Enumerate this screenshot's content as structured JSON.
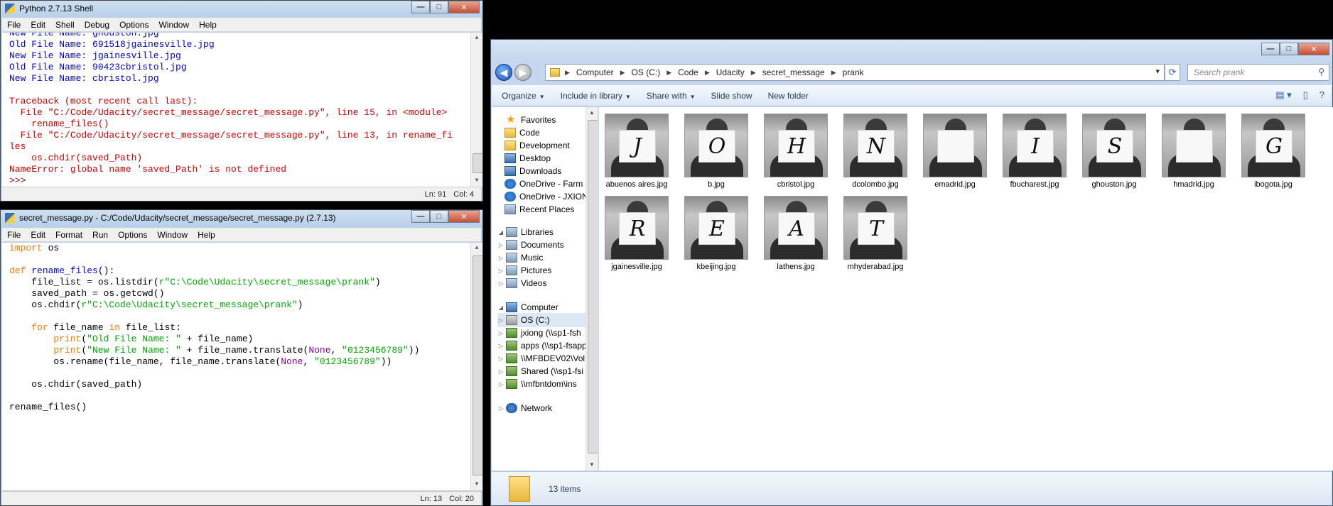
{
  "shell": {
    "title": "Python 2.7.13 Shell",
    "menu": [
      "File",
      "Edit",
      "Shell",
      "Debug",
      "Options",
      "Window",
      "Help"
    ],
    "lines": [
      {
        "text": "New File Name: ghouston.jpg",
        "cls": "c-blue"
      },
      {
        "text": "Old File Name: 691518jgainesville.jpg",
        "cls": "c-blue"
      },
      {
        "text": "New File Name: jgainesville.jpg",
        "cls": "c-blue"
      },
      {
        "text": "Old File Name: 90423cbristol.jpg",
        "cls": "c-blue"
      },
      {
        "text": "New File Name: cbristol.jpg",
        "cls": "c-blue"
      },
      {
        "text": "",
        "cls": ""
      },
      {
        "text": "Traceback (most recent call last):",
        "cls": "c-red"
      },
      {
        "text": "  File \"C:/Code/Udacity/secret_message/secret_message.py\", line 15, in <module>",
        "cls": "c-red"
      },
      {
        "text": "    rename_files()",
        "cls": "c-red"
      },
      {
        "text": "  File \"C:/Code/Udacity/secret_message/secret_message.py\", line 13, in rename_fi",
        "cls": "c-red"
      },
      {
        "text": "les",
        "cls": "c-red"
      },
      {
        "text": "    os.chdir(saved_Path)",
        "cls": "c-red"
      },
      {
        "text": "NameError: global name 'saved_Path' is not defined",
        "cls": "c-red"
      },
      {
        "text": ">>> ",
        "cls": "c-prompt"
      }
    ],
    "status_ln": "Ln: 91",
    "status_col": "Col: 4"
  },
  "editor": {
    "title": "secret_message.py - C:/Code/Udacity/secret_message/secret_message.py (2.7.13)",
    "menu": [
      "File",
      "Edit",
      "Format",
      "Run",
      "Options",
      "Window",
      "Help"
    ],
    "code": [
      [
        {
          "t": "import",
          "c": "c-kw"
        },
        {
          "t": " os",
          "c": ""
        }
      ],
      [],
      [
        {
          "t": "def",
          "c": "c-kw"
        },
        {
          "t": " ",
          "c": ""
        },
        {
          "t": "rename_files",
          "c": "c-def"
        },
        {
          "t": "():",
          "c": ""
        }
      ],
      [
        {
          "t": "    file_list = os.listdir(",
          "c": ""
        },
        {
          "t": "r\"C:\\Code\\Udacity\\secret_message\\prank\"",
          "c": "c-str"
        },
        {
          "t": ")",
          "c": ""
        }
      ],
      [
        {
          "t": "    saved_path = os.getcwd()",
          "c": ""
        }
      ],
      [
        {
          "t": "    os.chdir(",
          "c": ""
        },
        {
          "t": "r\"C:\\Code\\Udacity\\secret_message\\prank\"",
          "c": "c-str"
        },
        {
          "t": ")",
          "c": ""
        }
      ],
      [],
      [
        {
          "t": "    ",
          "c": ""
        },
        {
          "t": "for",
          "c": "c-kw"
        },
        {
          "t": " file_name ",
          "c": ""
        },
        {
          "t": "in",
          "c": "c-kw"
        },
        {
          "t": " file_list:",
          "c": ""
        }
      ],
      [
        {
          "t": "        ",
          "c": ""
        },
        {
          "t": "print",
          "c": "c-kw"
        },
        {
          "t": "(",
          "c": ""
        },
        {
          "t": "\"Old File Name: \"",
          "c": "c-str"
        },
        {
          "t": " + file_name)",
          "c": ""
        }
      ],
      [
        {
          "t": "        ",
          "c": ""
        },
        {
          "t": "print",
          "c": "c-kw"
        },
        {
          "t": "(",
          "c": ""
        },
        {
          "t": "\"New File Name: \"",
          "c": "c-str"
        },
        {
          "t": " + file_name.translate(",
          "c": ""
        },
        {
          "t": "None",
          "c": "c-bi"
        },
        {
          "t": ", ",
          "c": ""
        },
        {
          "t": "\"0123456789\"",
          "c": "c-str"
        },
        {
          "t": "))",
          "c": ""
        }
      ],
      [
        {
          "t": "        os.rename(file_name, file_name.translate(",
          "c": ""
        },
        {
          "t": "None",
          "c": "c-bi"
        },
        {
          "t": ", ",
          "c": ""
        },
        {
          "t": "\"0123456789\"",
          "c": "c-str"
        },
        {
          "t": "))",
          "c": ""
        }
      ],
      [],
      [
        {
          "t": "    os.chdir(saved_path)",
          "c": ""
        }
      ],
      [],
      [
        {
          "t": "rename_files()",
          "c": ""
        }
      ]
    ],
    "status_ln": "Ln: 13",
    "status_col": "Col: 20"
  },
  "explorer": {
    "breadcrumb": [
      "Computer",
      "OS (C:)",
      "Code",
      "Udacity",
      "secret_message",
      "prank"
    ],
    "search_placeholder": "Search prank",
    "commands": [
      "Organize",
      "Include in library",
      "Share with",
      "Slide show",
      "New folder"
    ],
    "nav": [
      {
        "label": "Favorites",
        "icon": "star-icon",
        "kind": "star",
        "exp": ""
      },
      {
        "label": "Code",
        "icon": "folder-icon",
        "kind": "folder",
        "exp": ""
      },
      {
        "label": "Development",
        "icon": "folder-icon",
        "kind": "folder",
        "exp": ""
      },
      {
        "label": "Desktop",
        "icon": "desktop-icon",
        "kind": "comp",
        "exp": ""
      },
      {
        "label": "Downloads",
        "icon": "downloads-icon",
        "kind": "comp",
        "exp": ""
      },
      {
        "label": "OneDrive - Farm",
        "icon": "onedrive-icon",
        "kind": "cloud",
        "exp": ""
      },
      {
        "label": "OneDrive - JXION",
        "icon": "onedrive-icon",
        "kind": "cloud",
        "exp": ""
      },
      {
        "label": "Recent Places",
        "icon": "recent-places-icon",
        "kind": "lib",
        "exp": ""
      },
      {
        "label": "Libraries",
        "icon": "libraries-icon",
        "kind": "lib",
        "exp": "◢"
      },
      {
        "label": "Documents",
        "icon": "documents-icon",
        "kind": "lib",
        "exp": "▷"
      },
      {
        "label": "Music",
        "icon": "music-icon",
        "kind": "lib",
        "exp": "▷"
      },
      {
        "label": "Pictures",
        "icon": "pictures-icon",
        "kind": "lib",
        "exp": "▷"
      },
      {
        "label": "Videos",
        "icon": "videos-icon",
        "kind": "lib",
        "exp": "▷"
      },
      {
        "label": "Computer",
        "icon": "computer-icon",
        "kind": "comp",
        "exp": "◢"
      },
      {
        "label": "OS (C:)",
        "icon": "drive-icon",
        "kind": "drive",
        "exp": "▷"
      },
      {
        "label": "jxiong (\\\\sp1-fsh",
        "icon": "network-drive-icon",
        "kind": "net",
        "exp": "▷"
      },
      {
        "label": "apps (\\\\sp1-fsapp",
        "icon": "network-drive-icon",
        "kind": "net",
        "exp": "▷"
      },
      {
        "label": "\\\\MFBDEV02\\Vol",
        "icon": "network-drive-icon",
        "kind": "net",
        "exp": "▷"
      },
      {
        "label": "Shared (\\\\sp1-fsi",
        "icon": "network-drive-icon",
        "kind": "net",
        "exp": "▷"
      },
      {
        "label": "\\\\mfbntdom\\ins",
        "icon": "network-drive-icon",
        "kind": "net",
        "exp": "▷"
      },
      {
        "label": "Network",
        "icon": "network-icon",
        "kind": "net2",
        "exp": "▷"
      }
    ],
    "files": [
      {
        "name": "abuenos aires.jpg",
        "letter": "J"
      },
      {
        "name": "b.jpg",
        "letter": "O"
      },
      {
        "name": "cbristol.jpg",
        "letter": "H"
      },
      {
        "name": "dcolombo.jpg",
        "letter": "N"
      },
      {
        "name": "emadrid.jpg",
        "letter": ""
      },
      {
        "name": "fbucharest.jpg",
        "letter": "I"
      },
      {
        "name": "ghouston.jpg",
        "letter": "S"
      },
      {
        "name": "hmadrid.jpg",
        "letter": ""
      },
      {
        "name": "ibogota.jpg",
        "letter": "G"
      },
      {
        "name": "jgainesville.jpg",
        "letter": "R"
      },
      {
        "name": "kbeijing.jpg",
        "letter": "E"
      },
      {
        "name": "lathens.jpg",
        "letter": "A"
      },
      {
        "name": "mhyderabad.jpg",
        "letter": "T"
      }
    ],
    "item_count": "13 items"
  }
}
